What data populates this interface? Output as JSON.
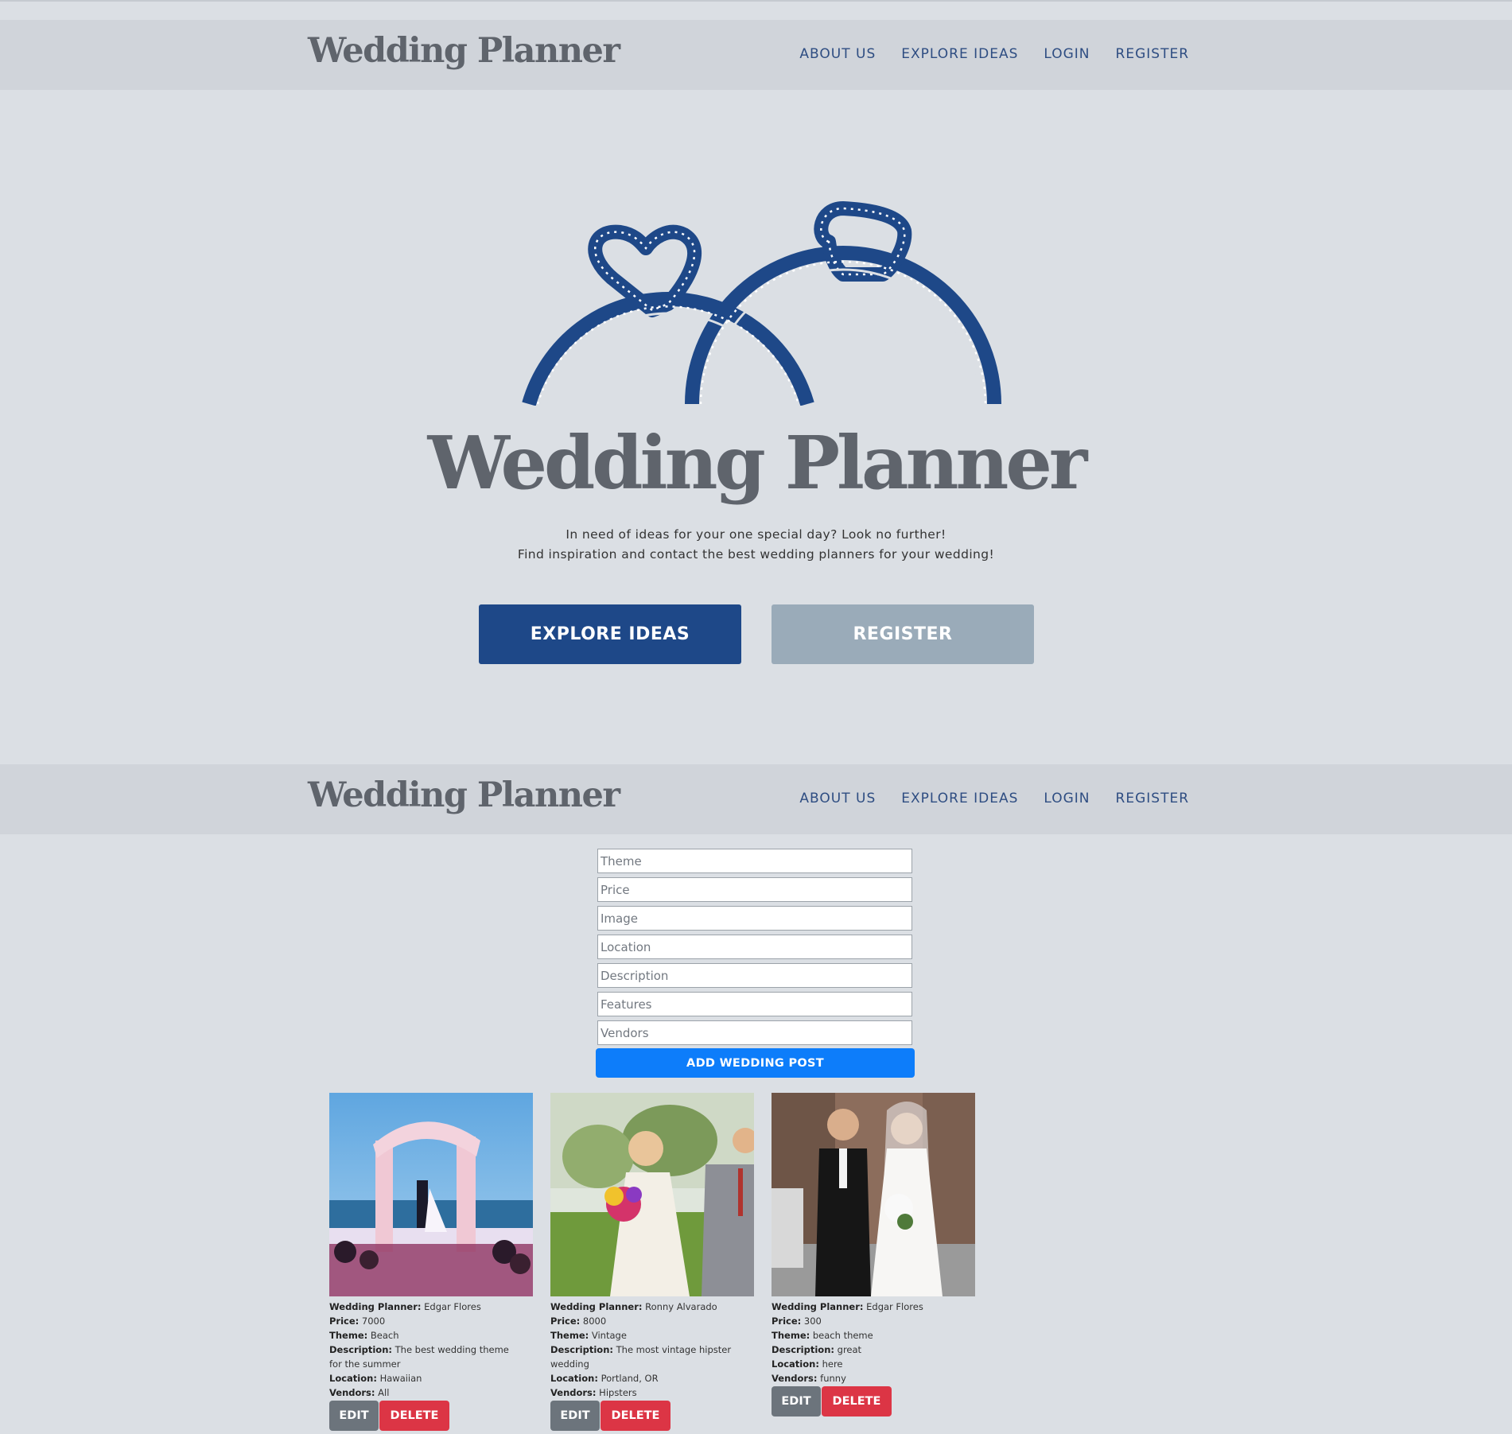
{
  "brand": "Wedding Planner",
  "nav": [
    "ABOUT US",
    "EXPLORE IDEAS",
    "LOGIN",
    "REGISTER"
  ],
  "hero": {
    "title": "Wedding Planner",
    "tagline_1": "In need of ideas for your one special day? Look no further!",
    "tagline_2": "Find inspiration and contact the best wedding planners for your wedding!",
    "explore_button": "EXPLORE IDEAS",
    "register_button": "REGISTER"
  },
  "form": {
    "placeholders": [
      "Theme",
      "Price",
      "Image",
      "Location",
      "Description",
      "Features",
      "Vendors"
    ],
    "submit": "ADD WEDDING POST"
  },
  "labels": {
    "planner": "Wedding Planner:",
    "price": "Price:",
    "theme": "Theme:",
    "description": "Description:",
    "location": "Location:",
    "vendors": "Vendors:",
    "edit": "EDIT",
    "delete": "DELETE"
  },
  "posts": [
    {
      "planner": "Edgar Flores",
      "price": "7000",
      "theme": "Beach",
      "description": "The best wedding theme for the summer",
      "location": "Hawaiian",
      "vendors": "All"
    },
    {
      "planner": "Ronny Alvarado",
      "price": "8000",
      "theme": "Vintage",
      "description": "The most vintage hipster wedding",
      "location": "Portland, OR",
      "vendors": "Hipsters"
    },
    {
      "planner": "Edgar Flores",
      "price": "300",
      "theme": "beach theme",
      "description": "great",
      "location": "here",
      "vendors": "funny"
    }
  ],
  "colors": {
    "page_bg": "#dbdfe4",
    "navbar_bg": "#d0d4da",
    "nav_link": "#2e4d82",
    "brand_text": "#5f646c",
    "ring": "#1e4888",
    "primary_button": "#1e4888",
    "secondary_button": "#9aabb9",
    "add_button": "#0d7dfa",
    "edit_button": "#6c747c",
    "delete_button": "#dc3545"
  },
  "icons": [
    "wedding-rings-icon"
  ]
}
